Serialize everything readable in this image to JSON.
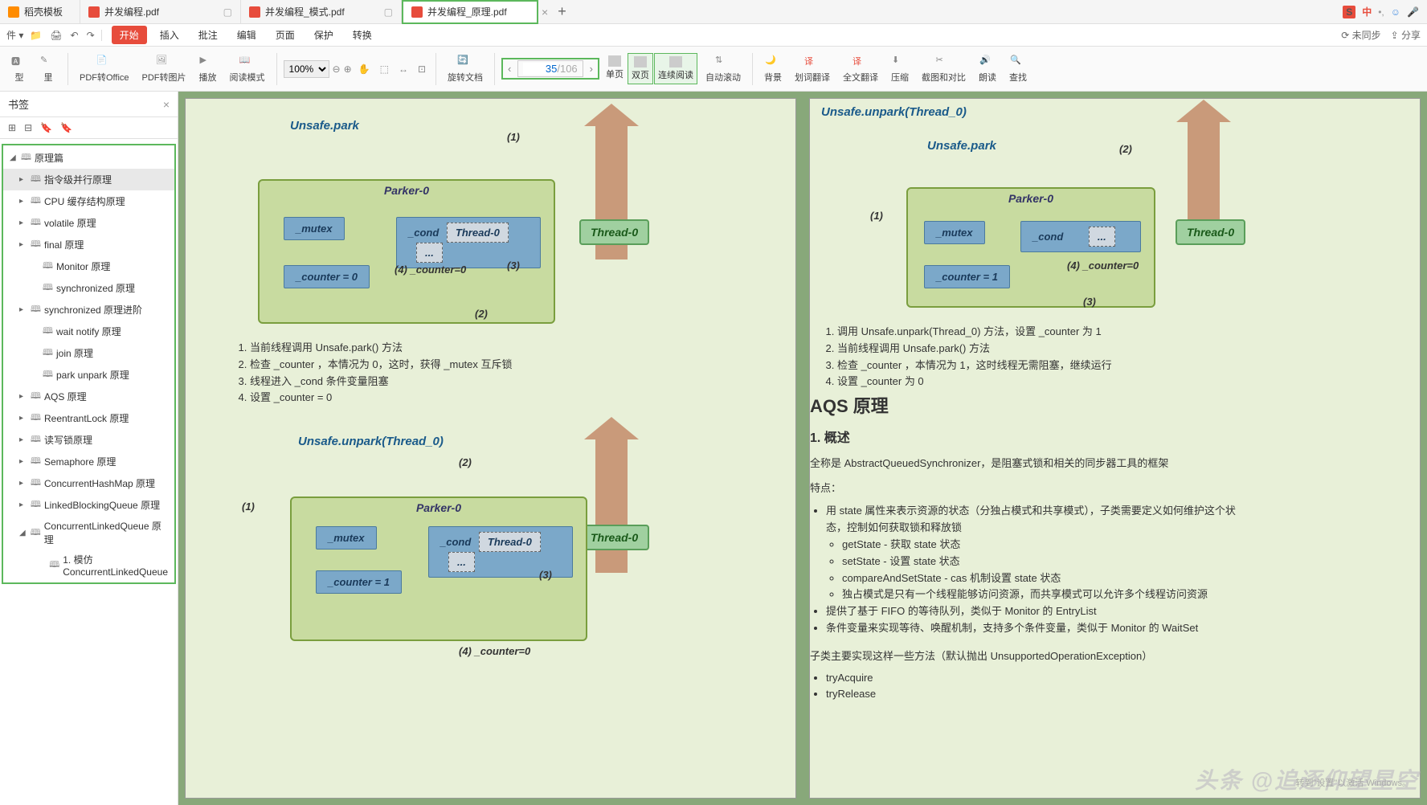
{
  "tabs": [
    {
      "label": "稻壳模板",
      "iconColor": "orange"
    },
    {
      "label": "并发编程.pdf",
      "iconColor": "red"
    },
    {
      "label": "并发编程_模式.pdf",
      "iconColor": "red"
    },
    {
      "label": "并发编程_原理.pdf",
      "iconColor": "red",
      "active": true
    }
  ],
  "ime": {
    "badge": "S",
    "lang": "中"
  },
  "menus": [
    "开始",
    "插入",
    "批注",
    "编辑",
    "页面",
    "保护",
    "转换"
  ],
  "menuRight": {
    "sync": "未同步",
    "share": "分享"
  },
  "toolbar": {
    "pdfToOffice": "PDF转Office",
    "pdfToImage": "PDF转图片",
    "play": "播放",
    "readMode": "阅读模式",
    "zoom": "100%",
    "rotate": "旋转文档",
    "single": "单页",
    "double": "双页",
    "continuous": "连续阅读",
    "autoScroll": "自动滚动",
    "background": "背景",
    "wordTranslate": "划词翻译",
    "fullTranslate": "全文翻译",
    "compress": "压缩",
    "screenshot": "截图和对比",
    "speak": "朗读",
    "find": "查找"
  },
  "pageNav": {
    "current": "35",
    "total": "/106"
  },
  "sidebar": {
    "title": "书签",
    "items": [
      {
        "label": "原理篇",
        "indent": 0,
        "open": true
      },
      {
        "label": "指令级并行原理",
        "indent": 1,
        "toggle": true,
        "sel": true
      },
      {
        "label": "CPU 缓存结构原理",
        "indent": 1,
        "toggle": true
      },
      {
        "label": "volatile 原理",
        "indent": 1,
        "toggle": true
      },
      {
        "label": "final 原理",
        "indent": 1,
        "toggle": true
      },
      {
        "label": "Monitor 原理",
        "indent": 2
      },
      {
        "label": "synchronized 原理",
        "indent": 2
      },
      {
        "label": "synchronized 原理进阶",
        "indent": 1,
        "toggle": true
      },
      {
        "label": "wait notify 原理",
        "indent": 2
      },
      {
        "label": "join 原理",
        "indent": 2
      },
      {
        "label": "park unpark 原理",
        "indent": 2
      },
      {
        "label": "AQS 原理",
        "indent": 1,
        "toggle": true
      },
      {
        "label": "ReentrantLock 原理",
        "indent": 1,
        "toggle": true
      },
      {
        "label": "读写锁原理",
        "indent": 1,
        "toggle": true
      },
      {
        "label": "Semaphore 原理",
        "indent": 1,
        "toggle": true
      },
      {
        "label": "ConcurrentHashMap 原理",
        "indent": 1,
        "toggle": true
      },
      {
        "label": "LinkedBlockingQueue 原理",
        "indent": 1,
        "toggle": true
      },
      {
        "label": "ConcurrentLinkedQueue 原理",
        "indent": 1,
        "toggle": true,
        "open": true
      },
      {
        "label": "1. 模仿 ConcurrentLinkedQueue",
        "indent": 3
      }
    ]
  },
  "pageLeft": {
    "diag1": {
      "title": "Unsafe.park",
      "parker": "Parker-0",
      "mutex": "_mutex",
      "cond": "_cond",
      "thread": "Thread-0",
      "dots": "...",
      "counter": "_counter = 0",
      "counterLabel": "(4)  _counter=0",
      "l1": "(1)",
      "l2": "(2)",
      "l3": "(3)",
      "outer": "Thread-0"
    },
    "steps1": [
      "当前线程调用 Unsafe.park() 方法",
      "检查 _counter ，本情况为 0，这时，获得 _mutex 互斥锁",
      "线程进入 _cond 条件变量阻塞",
      "设置 _counter = 0"
    ],
    "diag2": {
      "title": "Unsafe.unpark(Thread_0)",
      "parker": "Parker-0",
      "mutex": "_mutex",
      "cond": "_cond",
      "thread": "Thread-0",
      "dots": "...",
      "counter": "_counter = 1",
      "counterLabel": "(4)  _counter=0",
      "l1": "(1)",
      "l2": "(2)",
      "l3": "(3)",
      "outer": "Thread-0"
    }
  },
  "pageRight": {
    "diag1": {
      "title": "Unsafe.unpark(Thread_0)",
      "title2": "Unsafe.park",
      "parker": "Parker-0",
      "mutex": "_mutex",
      "cond": "_cond",
      "dots": "...",
      "counter": "_counter = 1",
      "counterLabel": "(4)  _counter=0",
      "l1": "(1)",
      "l2": "(2)",
      "l3": "(3)",
      "outer": "Thread-0"
    },
    "steps1": [
      "调用 Unsafe.unpark(Thread_0) 方法，设置 _counter 为 1",
      "当前线程调用 Unsafe.park() 方法",
      "检查 _counter ，本情况为 1，这时线程无需阻塞，继续运行",
      "设置 _counter 为 0"
    ],
    "aqsHeading": "AQS 原理",
    "overviewHeading": "1. 概述",
    "overview1": "全称是 AbstractQueuedSynchronizer，是阻塞式锁和相关的同步器工具的框架",
    "overview2": "特点：",
    "bullets": [
      "用 state 属性来表示资源的状态（分独占模式和共享模式），子类需要定义如何维护这个状态，控制如何获取锁和释放锁",
      "getState - 获取 state 状态",
      "setState - 设置 state 状态",
      "compareAndSetState - cas 机制设置 state 状态",
      "独占模式是只有一个线程能够访问资源，而共享模式可以允许多个线程访问资源",
      "提供了基于 FIFO 的等待队列，类似于 Monitor 的 EntryList",
      "条件变量来实现等待、唤醒机制，支持多个条件变量，类似于 Monitor 的 WaitSet"
    ],
    "subclass": "子类主要实现这样一些方法（默认抛出 UnsupportedOperationException）",
    "methods": [
      "tryAcquire",
      "tryRelease"
    ]
  },
  "watermark": "头条 @追逐仰望星空",
  "activate": "转到\"设置\"以激活 Windows。"
}
